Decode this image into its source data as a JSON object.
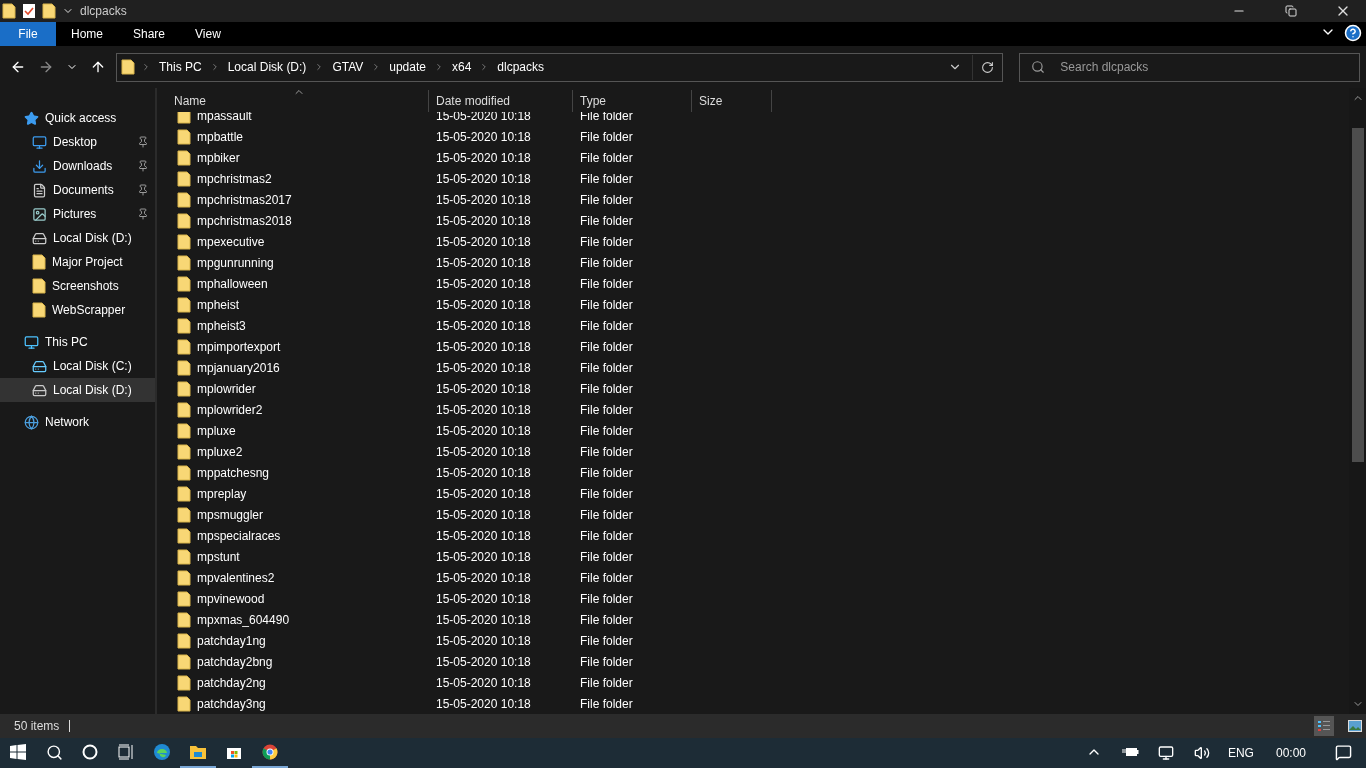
{
  "window": {
    "title": "dlcpacks"
  },
  "ribbon": {
    "tabs": [
      {
        "label": "File",
        "kind": "file"
      },
      {
        "label": "Home",
        "kind": "tab"
      },
      {
        "label": "Share",
        "kind": "tab"
      },
      {
        "label": "View",
        "kind": "tab"
      }
    ]
  },
  "address_bar": {
    "crumbs": [
      "This PC",
      "Local Disk (D:)",
      "GTAV",
      "update",
      "x64",
      "dlcpacks"
    ]
  },
  "search": {
    "placeholder": "Search dlcpacks"
  },
  "sidebar": {
    "items": [
      {
        "label": "Quick access",
        "kind": "star",
        "selected": false,
        "children": [
          {
            "label": "Desktop",
            "kind": "desktop",
            "pinned": true,
            "selected": false
          },
          {
            "label": "Downloads",
            "kind": "downloads",
            "pinned": true,
            "selected": false
          },
          {
            "label": "Documents",
            "kind": "documents",
            "pinned": true,
            "selected": false
          },
          {
            "label": "Pictures",
            "kind": "pictures",
            "pinned": true,
            "selected": false
          },
          {
            "label": "Local Disk (D:)",
            "kind": "drive",
            "pinned": false,
            "selected": false
          },
          {
            "label": "Major Project",
            "kind": "folder",
            "pinned": false,
            "selected": false
          },
          {
            "label": "Screenshots",
            "kind": "folder",
            "pinned": false,
            "selected": false
          },
          {
            "label": "WebScrapper",
            "kind": "folder",
            "pinned": false,
            "selected": false
          }
        ]
      },
      {
        "label": "This PC",
        "kind": "pc",
        "selected": false,
        "children": [
          {
            "label": "Local Disk (C:)",
            "kind": "system-drive",
            "pinned": false,
            "selected": false
          },
          {
            "label": "Local Disk (D:)",
            "kind": "drive",
            "pinned": false,
            "selected": true
          }
        ]
      },
      {
        "label": "Network",
        "kind": "network",
        "selected": false
      }
    ]
  },
  "table": {
    "columns": [
      "Name",
      "Date modified",
      "Type",
      "Size"
    ],
    "rows": [
      {
        "name": "mpassault",
        "date": "15-05-2020 10:18",
        "type": "File folder"
      },
      {
        "name": "mpbattle",
        "date": "15-05-2020 10:18",
        "type": "File folder"
      },
      {
        "name": "mpbiker",
        "date": "15-05-2020 10:18",
        "type": "File folder"
      },
      {
        "name": "mpchristmas2",
        "date": "15-05-2020 10:18",
        "type": "File folder"
      },
      {
        "name": "mpchristmas2017",
        "date": "15-05-2020 10:18",
        "type": "File folder"
      },
      {
        "name": "mpchristmas2018",
        "date": "15-05-2020 10:18",
        "type": "File folder"
      },
      {
        "name": "mpexecutive",
        "date": "15-05-2020 10:18",
        "type": "File folder"
      },
      {
        "name": "mpgunrunning",
        "date": "15-05-2020 10:18",
        "type": "File folder"
      },
      {
        "name": "mphalloween",
        "date": "15-05-2020 10:18",
        "type": "File folder"
      },
      {
        "name": "mpheist",
        "date": "15-05-2020 10:18",
        "type": "File folder"
      },
      {
        "name": "mpheist3",
        "date": "15-05-2020 10:18",
        "type": "File folder"
      },
      {
        "name": "mpimportexport",
        "date": "15-05-2020 10:18",
        "type": "File folder"
      },
      {
        "name": "mpjanuary2016",
        "date": "15-05-2020 10:18",
        "type": "File folder"
      },
      {
        "name": "mplowrider",
        "date": "15-05-2020 10:18",
        "type": "File folder"
      },
      {
        "name": "mplowrider2",
        "date": "15-05-2020 10:18",
        "type": "File folder"
      },
      {
        "name": "mpluxe",
        "date": "15-05-2020 10:18",
        "type": "File folder"
      },
      {
        "name": "mpluxe2",
        "date": "15-05-2020 10:18",
        "type": "File folder"
      },
      {
        "name": "mppatchesng",
        "date": "15-05-2020 10:18",
        "type": "File folder"
      },
      {
        "name": "mpreplay",
        "date": "15-05-2020 10:18",
        "type": "File folder"
      },
      {
        "name": "mpsmuggler",
        "date": "15-05-2020 10:18",
        "type": "File folder"
      },
      {
        "name": "mpspecialraces",
        "date": "15-05-2020 10:18",
        "type": "File folder"
      },
      {
        "name": "mpstunt",
        "date": "15-05-2020 10:18",
        "type": "File folder"
      },
      {
        "name": "mpvalentines2",
        "date": "15-05-2020 10:18",
        "type": "File folder"
      },
      {
        "name": "mpvinewood",
        "date": "15-05-2020 10:18",
        "type": "File folder"
      },
      {
        "name": "mpxmas_604490",
        "date": "15-05-2020 10:18",
        "type": "File folder"
      },
      {
        "name": "patchday1ng",
        "date": "15-05-2020 10:18",
        "type": "File folder"
      },
      {
        "name": "patchday2bng",
        "date": "15-05-2020 10:18",
        "type": "File folder"
      },
      {
        "name": "patchday2ng",
        "date": "15-05-2020 10:18",
        "type": "File folder"
      },
      {
        "name": "patchday3ng",
        "date": "15-05-2020 10:18",
        "type": "File folder"
      }
    ]
  },
  "status_bar": {
    "count": "50 items"
  },
  "taskbar": {
    "language": "ENG",
    "clock": "00:00"
  }
}
